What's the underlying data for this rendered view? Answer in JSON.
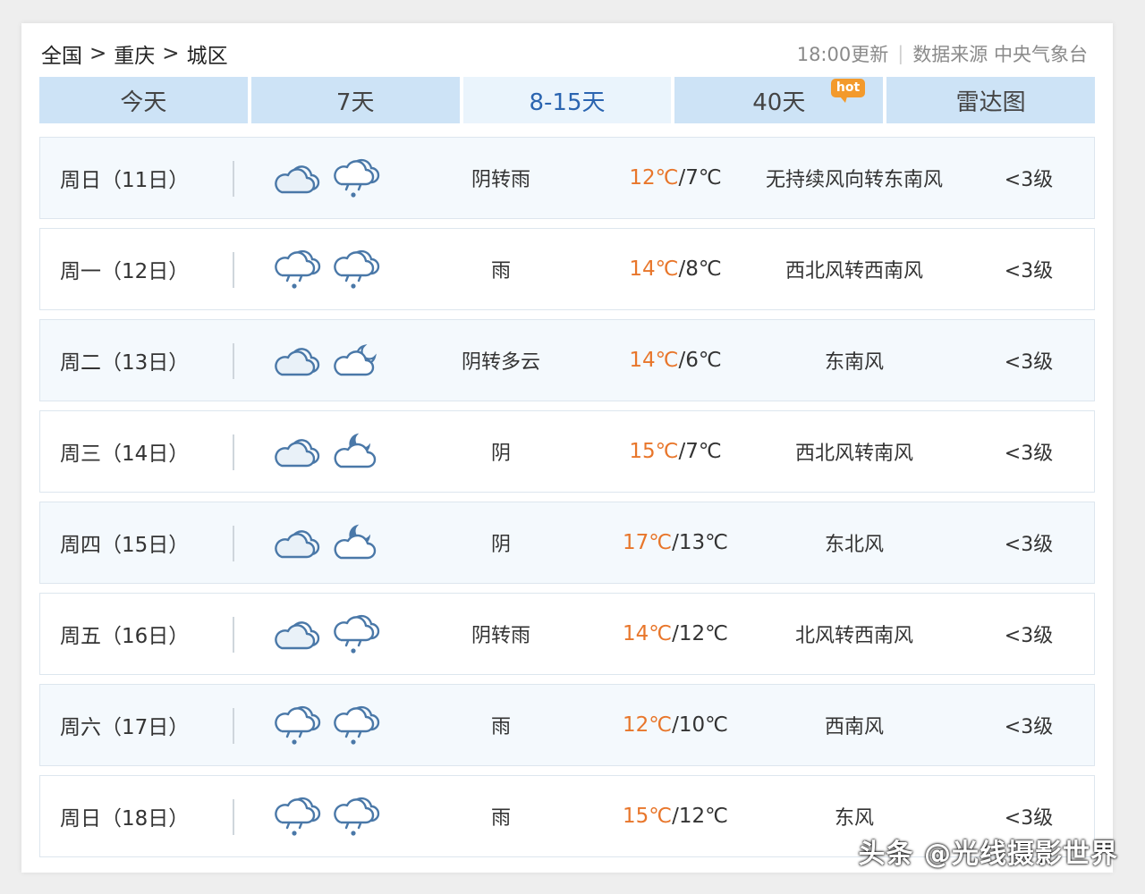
{
  "breadcrumb": {
    "items": [
      "全国",
      "重庆",
      "城区"
    ],
    "separator": ">"
  },
  "meta": {
    "updated": "18:00更新",
    "divider": "|",
    "source": "数据来源 中央气象台"
  },
  "tabs": [
    {
      "label": "今天",
      "active": false
    },
    {
      "label": "7天",
      "active": false
    },
    {
      "label": "8-15天",
      "active": true
    },
    {
      "label": "40天",
      "active": false,
      "badge": "hot"
    },
    {
      "label": "雷达图",
      "active": false
    }
  ],
  "forecast": [
    {
      "date": "周日（11日）",
      "icons": [
        "overcast-icon",
        "rain-icon"
      ],
      "weather": "阴转雨",
      "high": "12℃",
      "sep": "/",
      "low": "7℃",
      "wind": "无持续风向转东南风",
      "level": "<3级"
    },
    {
      "date": "周一（12日）",
      "icons": [
        "rain-icon",
        "rain-icon"
      ],
      "weather": "雨",
      "high": "14℃",
      "sep": "/",
      "low": "8℃",
      "wind": "西北风转西南风",
      "level": "<3级"
    },
    {
      "date": "周二（13日）",
      "icons": [
        "overcast-icon",
        "cloudy-night-icon"
      ],
      "weather": "阴转多云",
      "high": "14℃",
      "sep": "/",
      "low": "6℃",
      "wind": "东南风",
      "level": "<3级"
    },
    {
      "date": "周三（14日）",
      "icons": [
        "overcast-icon",
        "moon-cloud-icon"
      ],
      "weather": "阴",
      "high": "15℃",
      "sep": "/",
      "low": "7℃",
      "wind": "西北风转南风",
      "level": "<3级"
    },
    {
      "date": "周四（15日）",
      "icons": [
        "overcast-icon",
        "moon-cloud-icon"
      ],
      "weather": "阴",
      "high": "17℃",
      "sep": "/",
      "low": "13℃",
      "wind": "东北风",
      "level": "<3级"
    },
    {
      "date": "周五（16日）",
      "icons": [
        "overcast-icon",
        "rain-icon"
      ],
      "weather": "阴转雨",
      "high": "14℃",
      "sep": "/",
      "low": "12℃",
      "wind": "北风转西南风",
      "level": "<3级"
    },
    {
      "date": "周六（17日）",
      "icons": [
        "rain-icon",
        "rain-icon"
      ],
      "weather": "雨",
      "high": "12℃",
      "sep": "/",
      "low": "10℃",
      "wind": "西南风",
      "level": "<3级"
    },
    {
      "date": "周日（18日）",
      "icons": [
        "rain-icon",
        "rain-icon"
      ],
      "weather": "雨",
      "high": "15℃",
      "sep": "/",
      "low": "12℃",
      "wind": "东风",
      "level": "<3级"
    }
  ],
  "watermark": "头条 @光线摄影世界",
  "colors": {
    "tab_bg": "#cde3f6",
    "tab_active_text": "#2a64b0",
    "high_temp": "#e8762b",
    "icon_stroke": "#4a78a8",
    "hot_badge": "#f39a2c"
  }
}
